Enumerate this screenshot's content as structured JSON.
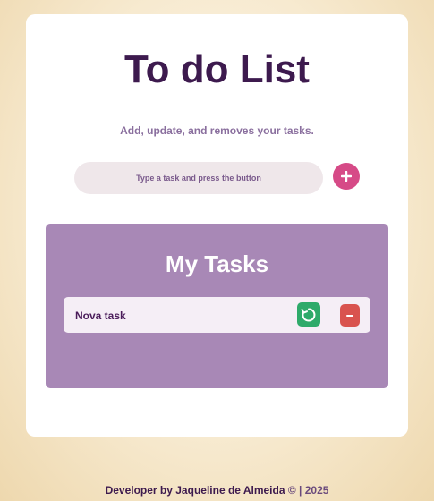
{
  "app": {
    "title": "To do List",
    "subtitle": "Add, update, and removes your tasks."
  },
  "input": {
    "placeholder": "Type a task and press the button",
    "value": ""
  },
  "add_button": {
    "icon": "plus-icon",
    "color": "#d64a87"
  },
  "tasks_panel": {
    "title": "My Tasks",
    "color": "#a888b6",
    "tasks": [
      {
        "text": "Nova task",
        "update_icon": "refresh-icon",
        "update_color": "#2eaa6a",
        "remove_icon": "minus-icon",
        "remove_color": "#d9534f"
      }
    ]
  },
  "footer": {
    "credit": "Developer by Jaqueline de Almeida",
    "copyright": "© | 2025"
  }
}
